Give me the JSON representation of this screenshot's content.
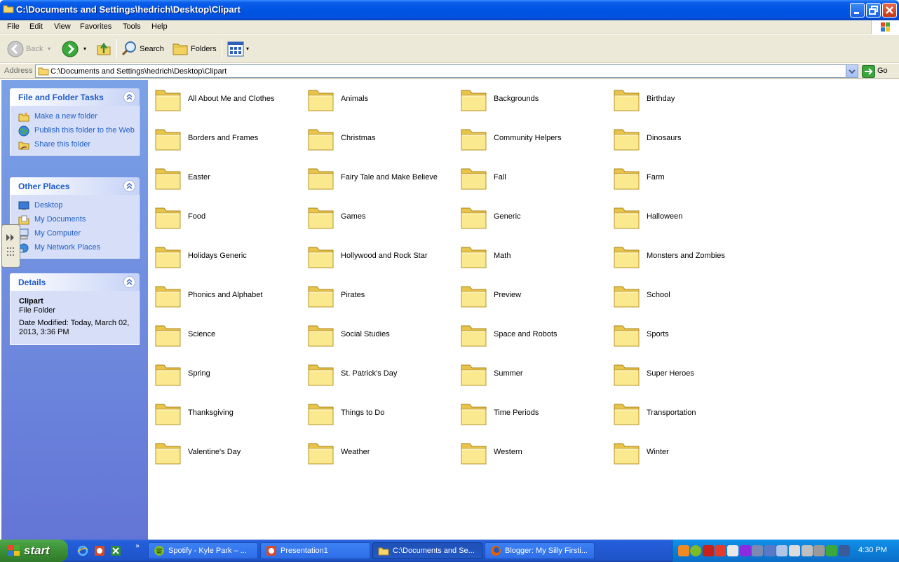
{
  "window": {
    "title": "C:\\Documents and Settings\\hedrich\\Desktop\\Clipart"
  },
  "menu": [
    "File",
    "Edit",
    "View",
    "Favorites",
    "Tools",
    "Help"
  ],
  "toolbar": {
    "back_label": "Back",
    "search_label": "Search",
    "folders_label": "Folders"
  },
  "address": {
    "label": "Address",
    "value": "C:\\Documents and Settings\\hedrich\\Desktop\\Clipart",
    "go_label": "Go"
  },
  "sidebar": {
    "file_tasks": {
      "title": "File and Folder Tasks",
      "items": [
        {
          "label": "Make a new folder",
          "icon": "new-folder-icon"
        },
        {
          "label": "Publish this folder to the Web",
          "icon": "publish-web-icon"
        },
        {
          "label": "Share this folder",
          "icon": "share-folder-icon"
        }
      ]
    },
    "other_places": {
      "title": "Other Places",
      "items": [
        {
          "label": "Desktop",
          "icon": "desktop-icon"
        },
        {
          "label": "My Documents",
          "icon": "my-documents-icon"
        },
        {
          "label": "My Computer",
          "icon": "my-computer-icon"
        },
        {
          "label": "My Network Places",
          "icon": "network-places-icon"
        }
      ]
    },
    "details": {
      "title": "Details",
      "name": "Clipart",
      "type": "File Folder",
      "modified": "Date Modified: Today, March 02, 2013, 3:36 PM"
    }
  },
  "folders": [
    "All About Me and Clothes",
    "Animals",
    "Backgrounds",
    "Birthday",
    "Borders and Frames",
    "Christmas",
    "Community Helpers",
    "Dinosaurs",
    "Easter",
    "Fairy Tale and Make Believe",
    "Fall",
    "Farm",
    "Food",
    "Games",
    "Generic",
    "Halloween",
    "Holidays Generic",
    "Hollywood and Rock Star",
    "Math",
    "Monsters and Zombies",
    "Phonics and Alphabet",
    "Pirates",
    "Preview",
    "School",
    "Science",
    "Social Studies",
    "Space and Robots",
    "Sports",
    "Spring",
    "St. Patrick's Day",
    "Summer",
    "Super Heroes",
    "Thanksgiving",
    "Things to Do",
    "Time Periods",
    "Transportation",
    "Valentine's Day",
    "Weather",
    "Western",
    "Winter"
  ],
  "taskbar": {
    "start_label": "start",
    "tasks": [
      {
        "label": "Spotify - Kyle Park – ...",
        "icon": "spotify-icon",
        "active": false
      },
      {
        "label": "Presentation1",
        "icon": "powerpoint-icon",
        "active": false
      },
      {
        "label": "C:\\Documents and Se...",
        "icon": "folder-icon",
        "active": true
      },
      {
        "label": "Blogger: My Silly Firsti...",
        "icon": "firefox-icon",
        "active": false
      }
    ],
    "clock": "4:30 PM"
  },
  "colors": {
    "title_blue": "#0054e3",
    "sidebar_link": "#215dc6",
    "folder_yellow": "#f8e27a",
    "start_green": "#3c8f34"
  }
}
